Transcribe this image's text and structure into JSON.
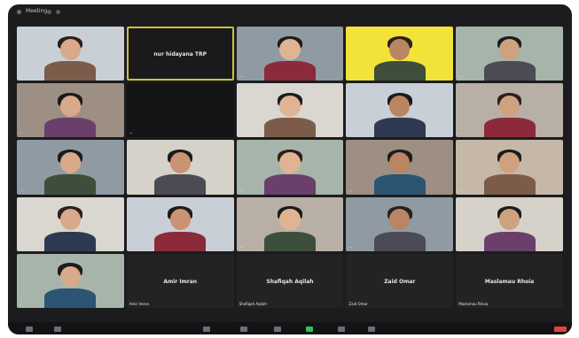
{
  "app": {
    "title": "Meeting"
  },
  "tiles": [
    {
      "kind": "video",
      "label": "—"
    },
    {
      "kind": "name",
      "name": "nur hidayana TRP",
      "label": ""
    },
    {
      "kind": "video",
      "label": "—"
    },
    {
      "kind": "video",
      "label": "—"
    },
    {
      "kind": "video",
      "label": "—"
    },
    {
      "kind": "video",
      "label": "—"
    },
    {
      "kind": "video",
      "label": "—"
    },
    {
      "kind": "video",
      "label": "—"
    },
    {
      "kind": "video",
      "label": "—"
    },
    {
      "kind": "video",
      "label": "—"
    },
    {
      "kind": "video",
      "label": "—"
    },
    {
      "kind": "video",
      "label": "—"
    },
    {
      "kind": "video",
      "label": "—"
    },
    {
      "kind": "video",
      "label": "—"
    },
    {
      "kind": "video",
      "label": "—"
    },
    {
      "kind": "video",
      "label": "—"
    },
    {
      "kind": "video",
      "label": "—"
    },
    {
      "kind": "video",
      "label": "—"
    },
    {
      "kind": "video",
      "label": "—"
    },
    {
      "kind": "video",
      "label": "—"
    },
    {
      "kind": "video",
      "label": "—"
    },
    {
      "kind": "name",
      "name": "Amir Imran",
      "label": "Amir Imran"
    },
    {
      "kind": "name",
      "name": "Shafiqah Aqilah",
      "label": "Shafiqah Aqilah"
    },
    {
      "kind": "name",
      "name": "Zaid Omar",
      "label": "Zaid Omar"
    },
    {
      "kind": "name",
      "name": "Maslamau Rhoia",
      "label": "Maslamau Rhoia"
    }
  ],
  "colors": {
    "window_bg": "#1c1c1e",
    "active_speaker": "#c9c23a",
    "yellow_bg": "#f2e23a"
  }
}
